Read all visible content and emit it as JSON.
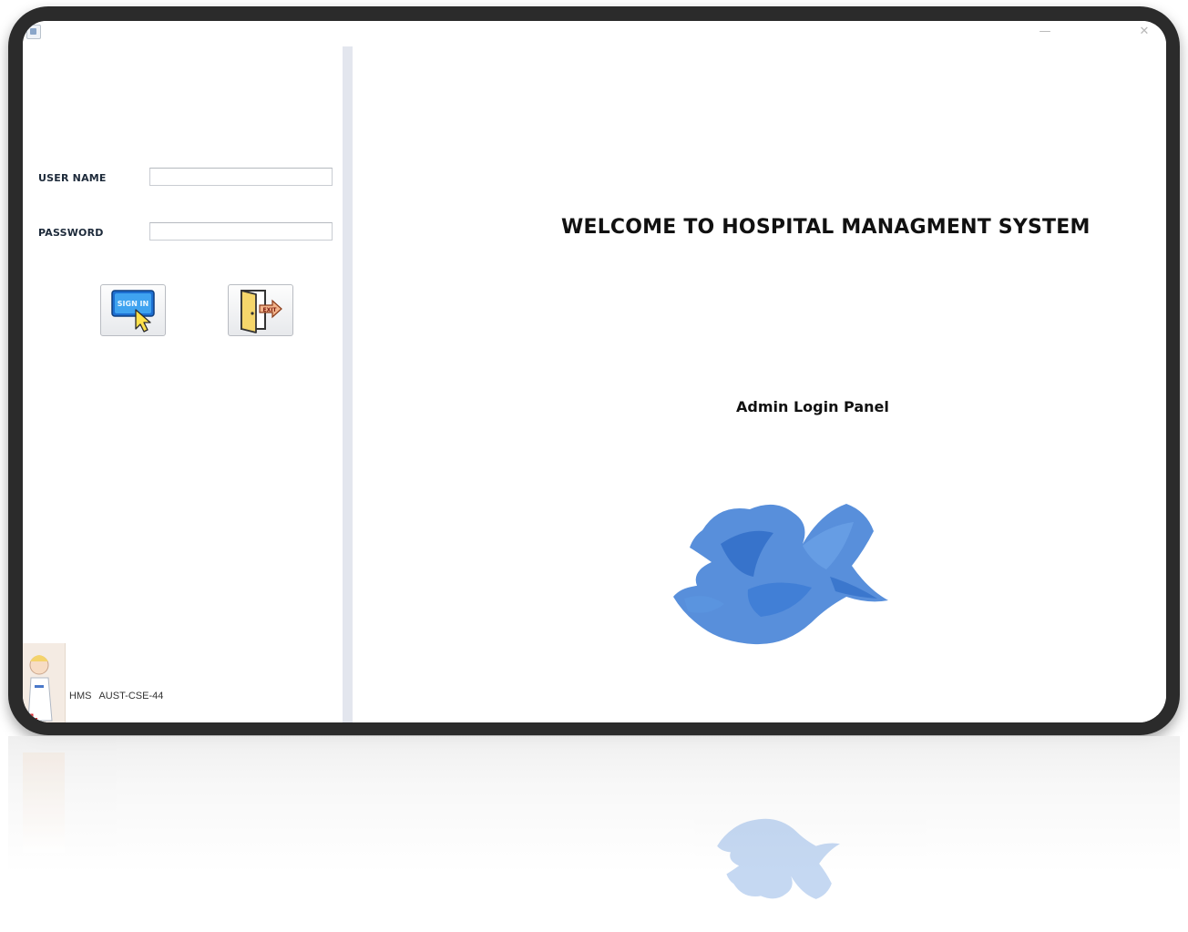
{
  "form": {
    "username_label": "USER NAME",
    "password_label": "PASSWORD",
    "username_value": "",
    "password_value": "",
    "signin_icon_text": "SIGN IN",
    "exit_icon_text": "EXIT"
  },
  "main": {
    "welcome_title": "WELCOME TO HOSPITAL MANAGMENT SYSTEM",
    "subtitle": "Admin Login Panel"
  },
  "footer": {
    "app_abbrev": "HMS",
    "course_code": "AUST-CSE-44"
  },
  "icons": {
    "app": "app-icon",
    "signin": "sign-in-cursor-icon",
    "exit": "exit-door-icon",
    "logo": "blue-bird-logo"
  },
  "colors": {
    "logo_blue": "#4a86d8",
    "divider": "#e3e6ee",
    "frame": "#2b2b2b"
  }
}
